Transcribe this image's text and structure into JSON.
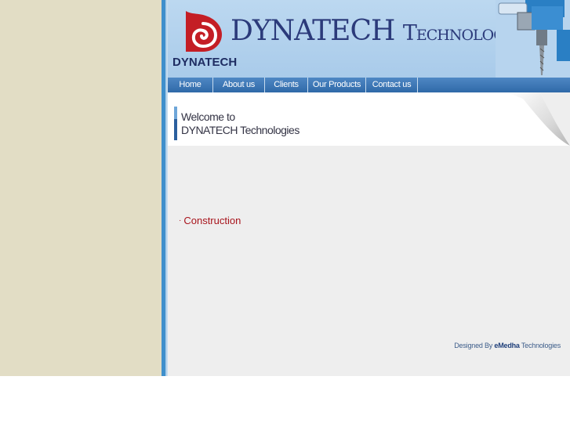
{
  "header": {
    "logo_brand": "DYNATECH",
    "title_main": "DYNATECH",
    "title_sub": "Technologies",
    "brand_color": "#2b3a7a",
    "logo_color": "#c41e25"
  },
  "nav": {
    "items": [
      {
        "label": "Home"
      },
      {
        "label": "About us"
      },
      {
        "label": "Clients"
      },
      {
        "label": "Our Products"
      },
      {
        "label": "Contact us"
      }
    ]
  },
  "welcome": {
    "line1": "Welcome to",
    "line2": "DYNATECH Technologies"
  },
  "content": {
    "link_bullet": "·",
    "link_label": "Construction"
  },
  "footer": {
    "credit_prefix": "Designed By",
    "credit_brand": "eMedha",
    "credit_suffix": "Technologies"
  }
}
